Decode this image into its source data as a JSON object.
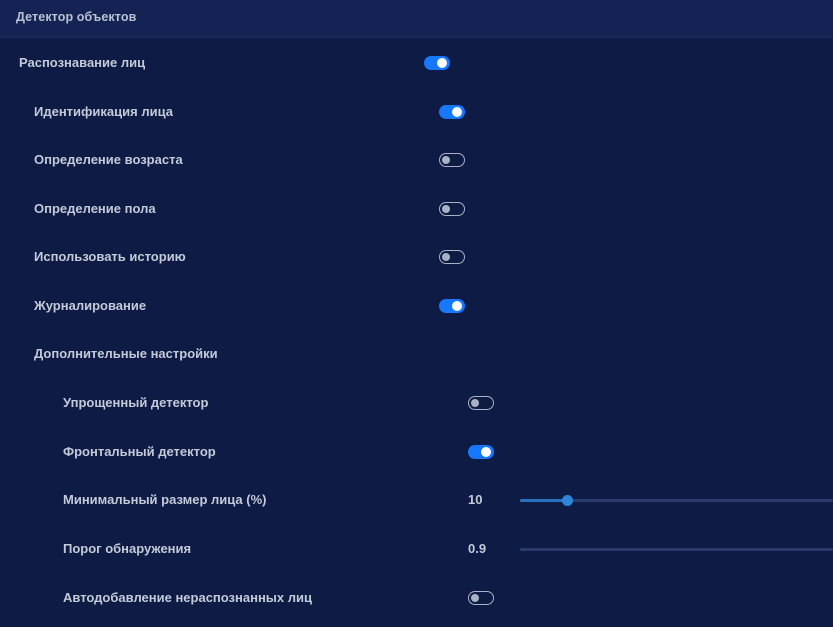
{
  "header": {
    "title": "Детектор объектов"
  },
  "settings": {
    "face_recognition": {
      "label": "Распознавание лиц",
      "enabled": true
    },
    "face_identification": {
      "label": "Идентификация лица",
      "enabled": true
    },
    "age_detection": {
      "label": "Определение возраста",
      "enabled": false
    },
    "gender_detection": {
      "label": "Определение пола",
      "enabled": false
    },
    "use_history": {
      "label": "Использовать историю",
      "enabled": false
    },
    "logging": {
      "label": "Журналирование",
      "enabled": true
    },
    "advanced": {
      "label": "Дополнительные настройки"
    },
    "simplified_detector": {
      "label": "Упрощенный детектор",
      "enabled": false
    },
    "frontal_detector": {
      "label": "Фронтальный детектор",
      "enabled": true
    },
    "min_face_size": {
      "label": "Минимальный размер лица (%)",
      "value": "10",
      "slider_fraction": 0.15
    },
    "detection_threshold": {
      "label": "Порог обнаружения",
      "value": "0.9",
      "slider_fraction": 0.0
    },
    "auto_add_unrecognized": {
      "label": "Автодобавление нераспознанных лиц",
      "enabled": false
    }
  },
  "colors": {
    "background": "#0d1b45",
    "header": "#142354",
    "toggle_on": "#1677ff",
    "toggle_off_border": "#aab1c2"
  }
}
